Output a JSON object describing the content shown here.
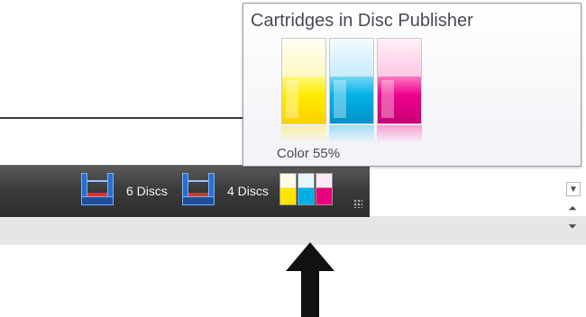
{
  "popup": {
    "title": "Cartridges in Disc Publisher",
    "color_label": "Color",
    "color_percent": "55%",
    "cartridges": [
      {
        "name": "yellow",
        "color": "#ffe600"
      },
      {
        "name": "cyan",
        "color": "#00aee6"
      },
      {
        "name": "magenta",
        "color": "#ec008c"
      }
    ]
  },
  "statusbar": {
    "bin1_label": "6 Discs",
    "bin2_label": "4 Discs"
  },
  "colors": {
    "statusbar_bg": "#3b3b3b",
    "tray_blue": "#2a6fd0",
    "tray_red": "#e03030"
  },
  "icons": {
    "scroll_down": "dropdown-arrow-icon",
    "scroll_up": "double-chevron-up-icon",
    "scroll_more": "double-chevron-down-icon",
    "resize": "resize-grip-icon",
    "pointer": "arrow-up-icon"
  }
}
